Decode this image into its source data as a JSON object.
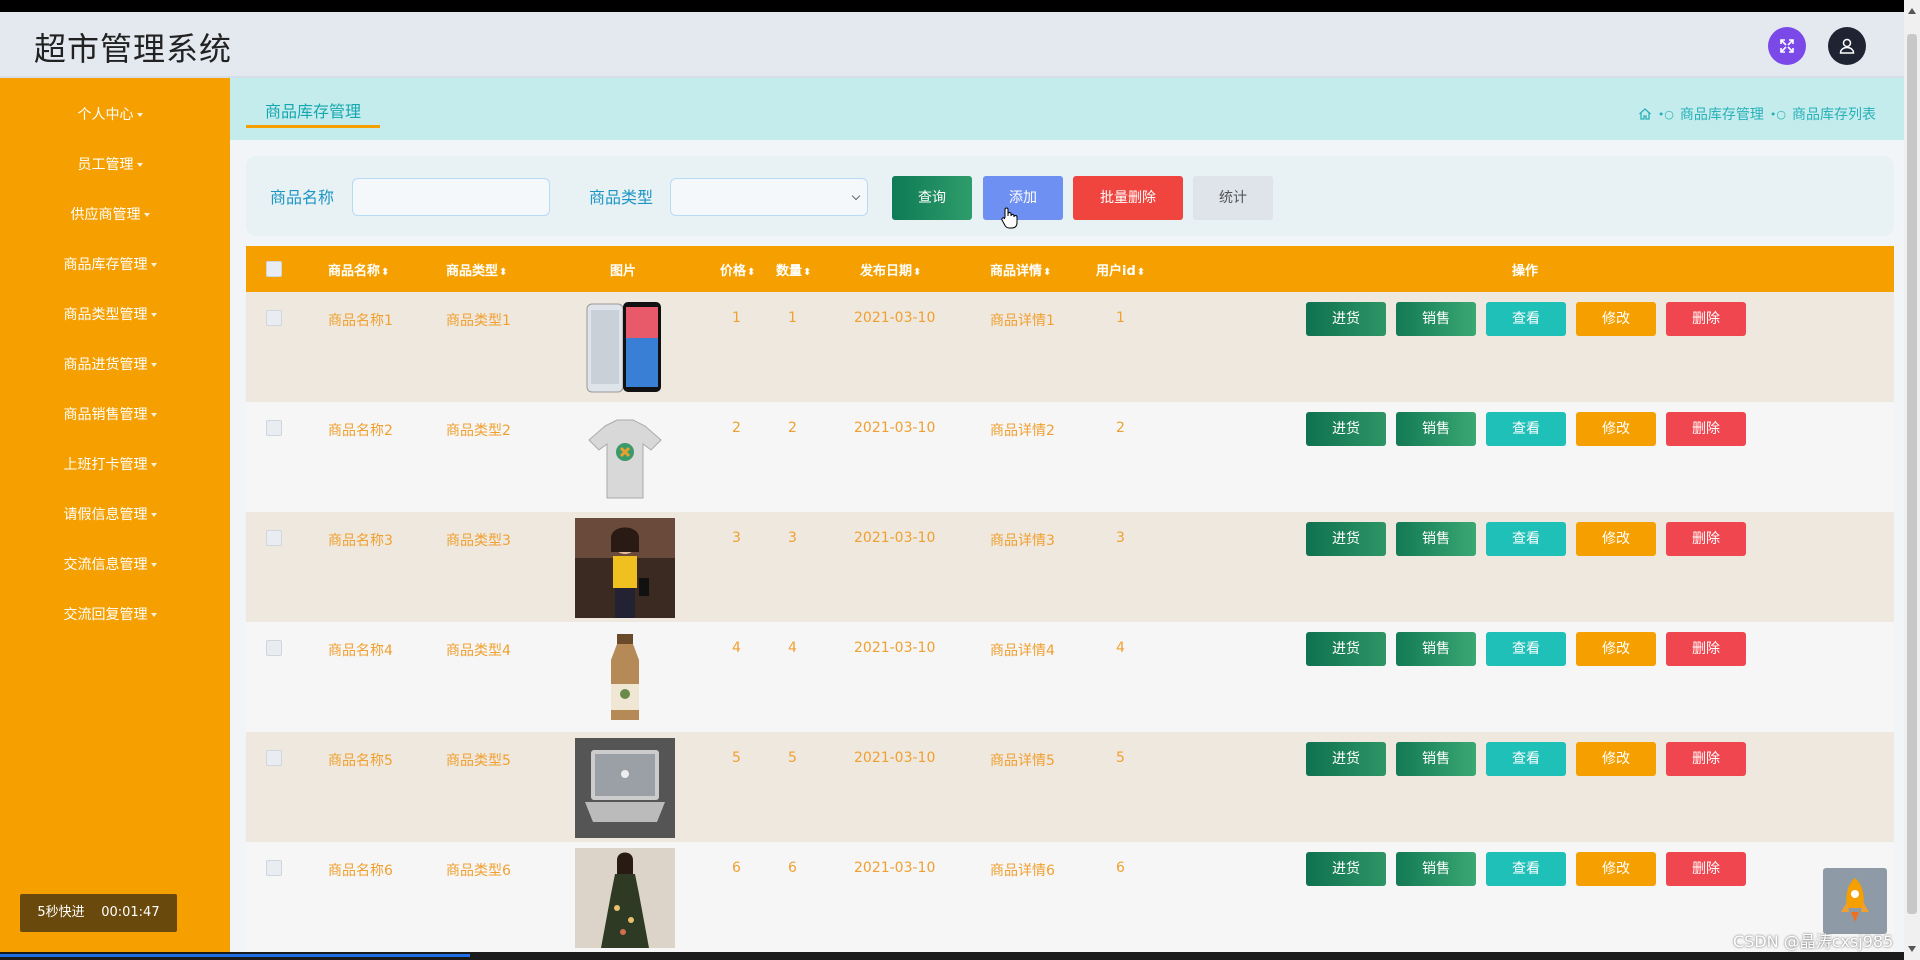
{
  "app": {
    "title": "超市管理系统"
  },
  "sidebar": {
    "items": [
      {
        "label": "个人中心"
      },
      {
        "label": "员工管理"
      },
      {
        "label": "供应商管理"
      },
      {
        "label": "商品库存管理"
      },
      {
        "label": "商品类型管理"
      },
      {
        "label": "商品进货管理"
      },
      {
        "label": "商品销售管理"
      },
      {
        "label": "上班打卡管理"
      },
      {
        "label": "请假信息管理"
      },
      {
        "label": "交流信息管理"
      },
      {
        "label": "交流回复管理"
      }
    ],
    "speed_label": "5秒快进",
    "timer": "00:01:47"
  },
  "tabs": {
    "active": "商品库存管理"
  },
  "breadcrumb": [
    "商品库存管理",
    "商品库存列表"
  ],
  "search": {
    "name_label": "商品名称",
    "name_value": "",
    "type_label": "商品类型",
    "type_value": "",
    "query_btn": "查询",
    "add_btn": "添加",
    "batch_delete_btn": "批量删除",
    "stats_btn": "统计"
  },
  "table": {
    "headers": [
      "商品名称",
      "商品类型",
      "图片",
      "价格",
      "数量",
      "发布日期",
      "商品详情",
      "用户id",
      "操作"
    ],
    "actions": [
      "进货",
      "销售",
      "查看",
      "修改",
      "删除"
    ],
    "rows": [
      {
        "name": "商品名称1",
        "type": "商品类型1",
        "image": "phone",
        "price": "1",
        "qty": "1",
        "date": "2021-03-10",
        "detail": "商品详情1",
        "userid": "1"
      },
      {
        "name": "商品名称2",
        "type": "商品类型2",
        "image": "t-shirt",
        "price": "2",
        "qty": "2",
        "date": "2021-03-10",
        "detail": "商品详情2",
        "userid": "2"
      },
      {
        "name": "商品名称3",
        "type": "商品类型3",
        "image": "woman-yellow-top",
        "price": "3",
        "qty": "3",
        "date": "2021-03-10",
        "detail": "商品详情3",
        "userid": "3"
      },
      {
        "name": "商品名称4",
        "type": "商品类型4",
        "image": "milk-tea-bottle",
        "price": "4",
        "qty": "4",
        "date": "2021-03-10",
        "detail": "商品详情4",
        "userid": "4"
      },
      {
        "name": "商品名称5",
        "type": "商品类型5",
        "image": "laptop",
        "price": "5",
        "qty": "5",
        "date": "2021-03-10",
        "detail": "商品详情5",
        "userid": "5"
      },
      {
        "name": "商品名称6",
        "type": "商品类型6",
        "image": "floral-dress",
        "price": "6",
        "qty": "6",
        "date": "2021-03-10",
        "detail": "商品详情6",
        "userid": "6"
      }
    ]
  },
  "watermark": "CSDN @晶涛cxsj985",
  "colors": {
    "sidebar": "#f5a000",
    "header_bg": "#e4e9f0",
    "accent_teal": "#14a7b0",
    "danger": "#f0453f"
  }
}
